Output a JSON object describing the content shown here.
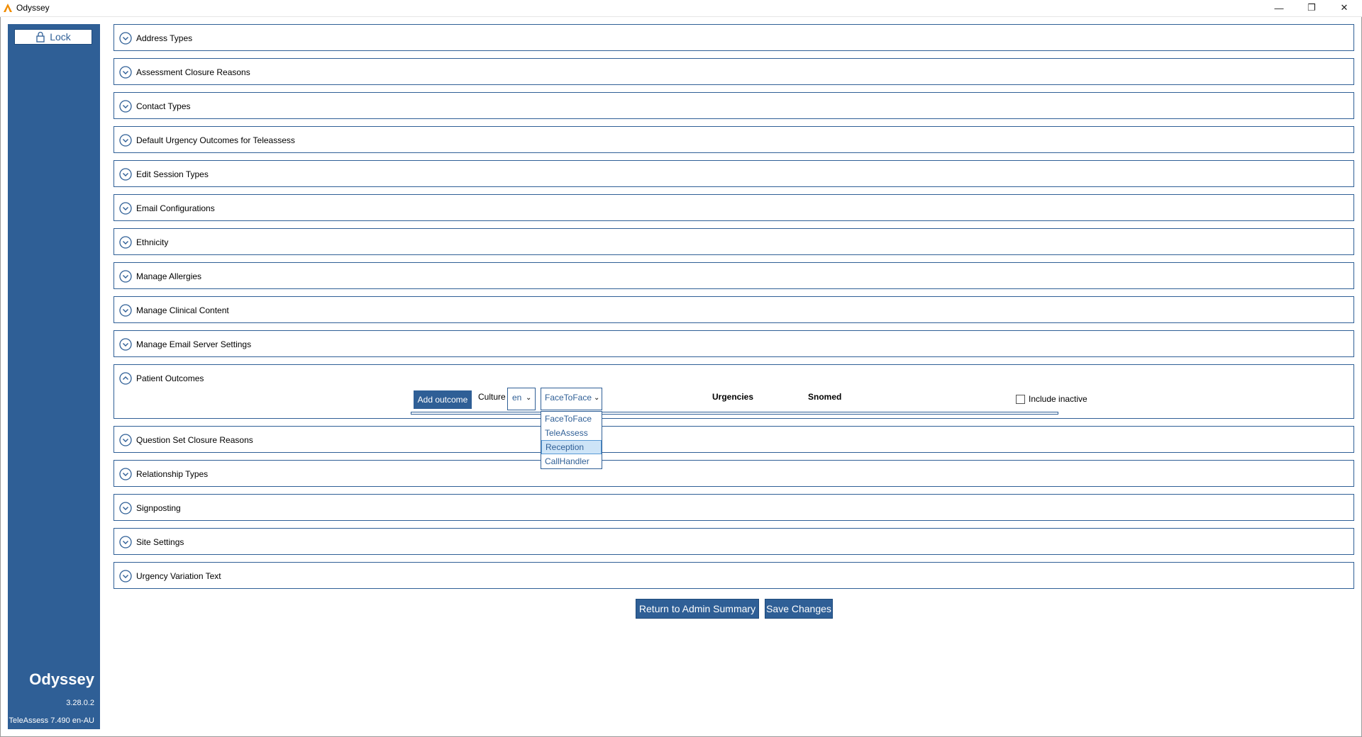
{
  "window": {
    "title": "Odyssey",
    "minimize_glyph": "—",
    "maximize_glyph": "❐",
    "close_glyph": "✕"
  },
  "sidebar": {
    "lock_label": "Lock",
    "app_name": "Odyssey",
    "version": "3.28.0.2",
    "teleassess": "TeleAssess 7.490 en-AU",
    "background_color": "#2f5f96"
  },
  "sections": [
    {
      "label": "Address Types",
      "expanded": false
    },
    {
      "label": "Assessment Closure Reasons",
      "expanded": false
    },
    {
      "label": "Contact Types",
      "expanded": false
    },
    {
      "label": "Default Urgency Outcomes for Teleassess",
      "expanded": false
    },
    {
      "label": "Edit Session Types",
      "expanded": false
    },
    {
      "label": "Email Configurations",
      "expanded": false
    },
    {
      "label": "Ethnicity",
      "expanded": false
    },
    {
      "label": "Manage Allergies",
      "expanded": false
    },
    {
      "label": "Manage Clinical Content",
      "expanded": false
    },
    {
      "label": "Manage Email Server Settings",
      "expanded": false
    },
    {
      "label": "Patient Outcomes",
      "expanded": true
    },
    {
      "label": "Question Set Closure Reasons",
      "expanded": false
    },
    {
      "label": "Relationship Types",
      "expanded": false
    },
    {
      "label": "Signposting",
      "expanded": false
    },
    {
      "label": "Site Settings",
      "expanded": false
    },
    {
      "label": "Urgency Variation Text",
      "expanded": false
    }
  ],
  "patient_outcomes": {
    "add_button": "Add outcome",
    "culture_label": "Culture",
    "culture_value": "en",
    "type_value": "FaceToFace",
    "col_urgencies": "Urgencies",
    "col_snomed": "Snomed",
    "include_inactive_label": "Include inactive",
    "include_inactive_checked": false,
    "type_options": [
      "FaceToFace",
      "TeleAssess",
      "Reception",
      "CallHandler"
    ],
    "highlighted_option": "Reception"
  },
  "footer": {
    "return_label": "Return to Admin Summary",
    "save_label": "Save Changes"
  },
  "icons": {
    "app": "odyssey-logo-icon",
    "lock": "lock-icon",
    "section_collapsed": "chevron-down-circle-icon",
    "section_expanded": "chevron-up-circle-icon",
    "dropdown": "chevron-down-icon"
  },
  "colors": {
    "accent": "#2f5f96",
    "logo": "#f08c00",
    "highlight": "#cde4f7"
  }
}
